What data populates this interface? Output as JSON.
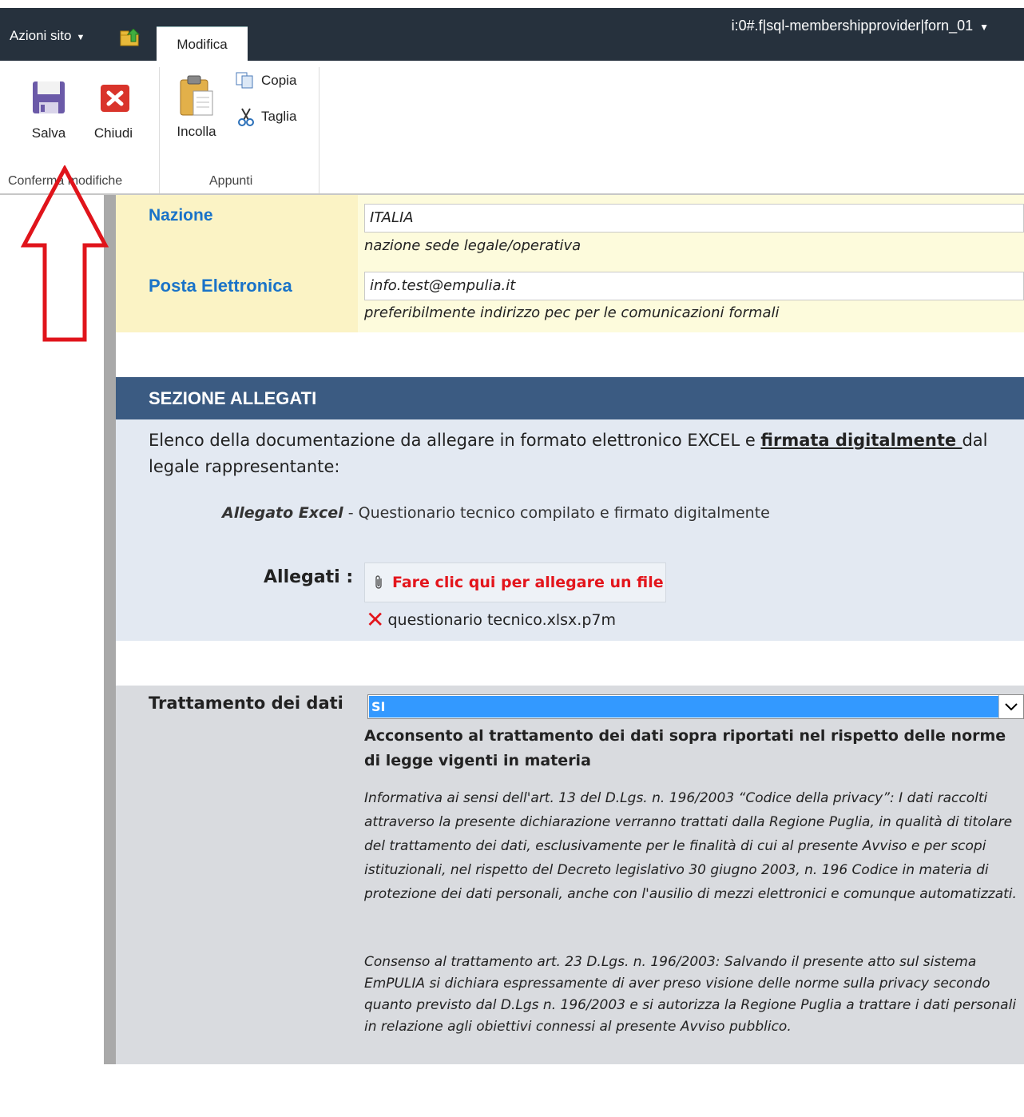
{
  "topbar": {
    "site_actions": "Azioni sito",
    "active_tab": "Modifica",
    "user": "i:0#.f|sql-membershipprovider|forn_01"
  },
  "ribbon": {
    "save": "Salva",
    "close": "Chiudi",
    "paste": "Incolla",
    "copy": "Copia",
    "cut": "Taglia",
    "group_commit": "Conferma modifiche",
    "group_clipboard": "Appunti"
  },
  "form": {
    "nation_label": "Nazione",
    "nation_value": "ITALIA",
    "nation_hint": "nazione sede legale/operativa",
    "email_label": "Posta Elettronica",
    "email_value": "info.test@empulia.it",
    "email_hint": "preferibilmente indirizzo pec per le comunicazioni formali"
  },
  "attachments": {
    "section_title": "SEZIONE ALLEGATI",
    "intro_pre": "Elenco della documentazione da allegare in formato elettronico EXCEL e ",
    "intro_underline": "firmata digitalmente ",
    "intro_post": "dal legale rappresentante:",
    "excel_bold": "Allegato Excel",
    "excel_rest": " - Questionario tecnico compilato e firmato digitalmente",
    "label": "Allegati :",
    "attach_button": "Fare clic qui per allegare un file",
    "file_name": "questionario tecnico.xlsx.p7m"
  },
  "consent": {
    "label": "Trattamento dei dati",
    "selected": "SI",
    "bold_text": "Acconsento al trattamento dei dati sopra riportati nel rispetto delle norme di legge vigenti in materia",
    "info_1": "Informativa ai sensi dell'art. 13 del D.Lgs. n. 196/2003 “Codice della privacy”: I dati raccolti attraverso la presente dichiarazione verranno trattati dalla Regione Puglia, in qualità di titolare del trattamento dei dati, esclusivamente per le finalità di cui al presente Avviso e per scopi istituzionali, nel rispetto del Decreto legislativo 30 giugno 2003, n. 196 Codice in materia di protezione dei dati personali, anche con l'ausilio di mezzi elettronici e comunque automatizzati.",
    "info_2": "Consenso al trattamento art. 23 D.Lgs. n. 196/2003: Salvando il presente atto sul sistema EmPULIA si dichiara espressamente di aver preso visione delle norme sulla privacy secondo quanto previsto dal D.Lgs n. 196/2003 e si autorizza la Regione Puglia a trattare i dati personali in relazione agli obiettivi connessi al presente Avviso pubblico."
  },
  "colors": {
    "topbar": "#26313d",
    "section_header": "#3b5b82",
    "label_blue": "#1a73c8",
    "alert_red": "#e3151c",
    "select_highlight": "#3399ff"
  }
}
